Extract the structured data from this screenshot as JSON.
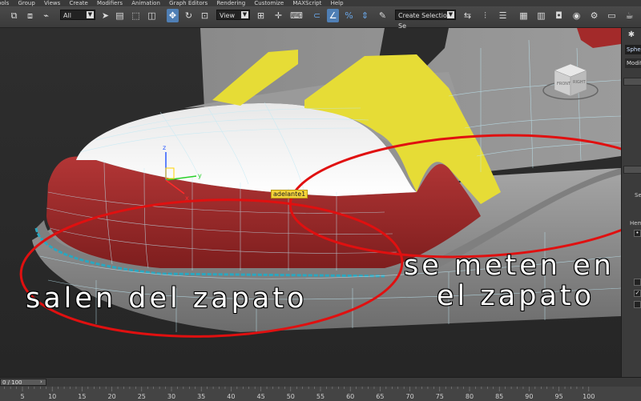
{
  "menu": [
    "Tools",
    "Group",
    "Views",
    "Create",
    "Modifiers",
    "Animation",
    "Graph Editors",
    "Rendering",
    "Customize",
    "MAXScript",
    "Help"
  ],
  "toolbar": {
    "selection_filter": "All",
    "reference_coord": "View",
    "named_selection": "Create Selection Se"
  },
  "viewport": {
    "object_label": "adelante1",
    "caption_left": "salen del zapato",
    "caption_right_line1": "se meten en",
    "caption_right_line2": "el zapato",
    "viewcube_front": "FRONT",
    "viewcube_right": "RIGHT",
    "colors": {
      "shoe_red": "#a32a2a",
      "shoe_yellow": "#e6dc36",
      "shoe_white": "#f2f2f2",
      "shoe_gray": "#8a8a8a",
      "wire": "#bfe9f5",
      "annotation": "#e01010"
    }
  },
  "command_panel": {
    "object_name": "Sphere",
    "modifier_list": "Modifi",
    "labels": [
      "Se",
      "Hem"
    ]
  },
  "timeline": {
    "frame_readout": "0 / 100",
    "ruler_ticks": [
      "5",
      "10",
      "15",
      "20",
      "25",
      "30",
      "35",
      "40",
      "45",
      "50",
      "55",
      "60",
      "65",
      "70",
      "75",
      "80",
      "85",
      "90",
      "95",
      "100"
    ]
  }
}
